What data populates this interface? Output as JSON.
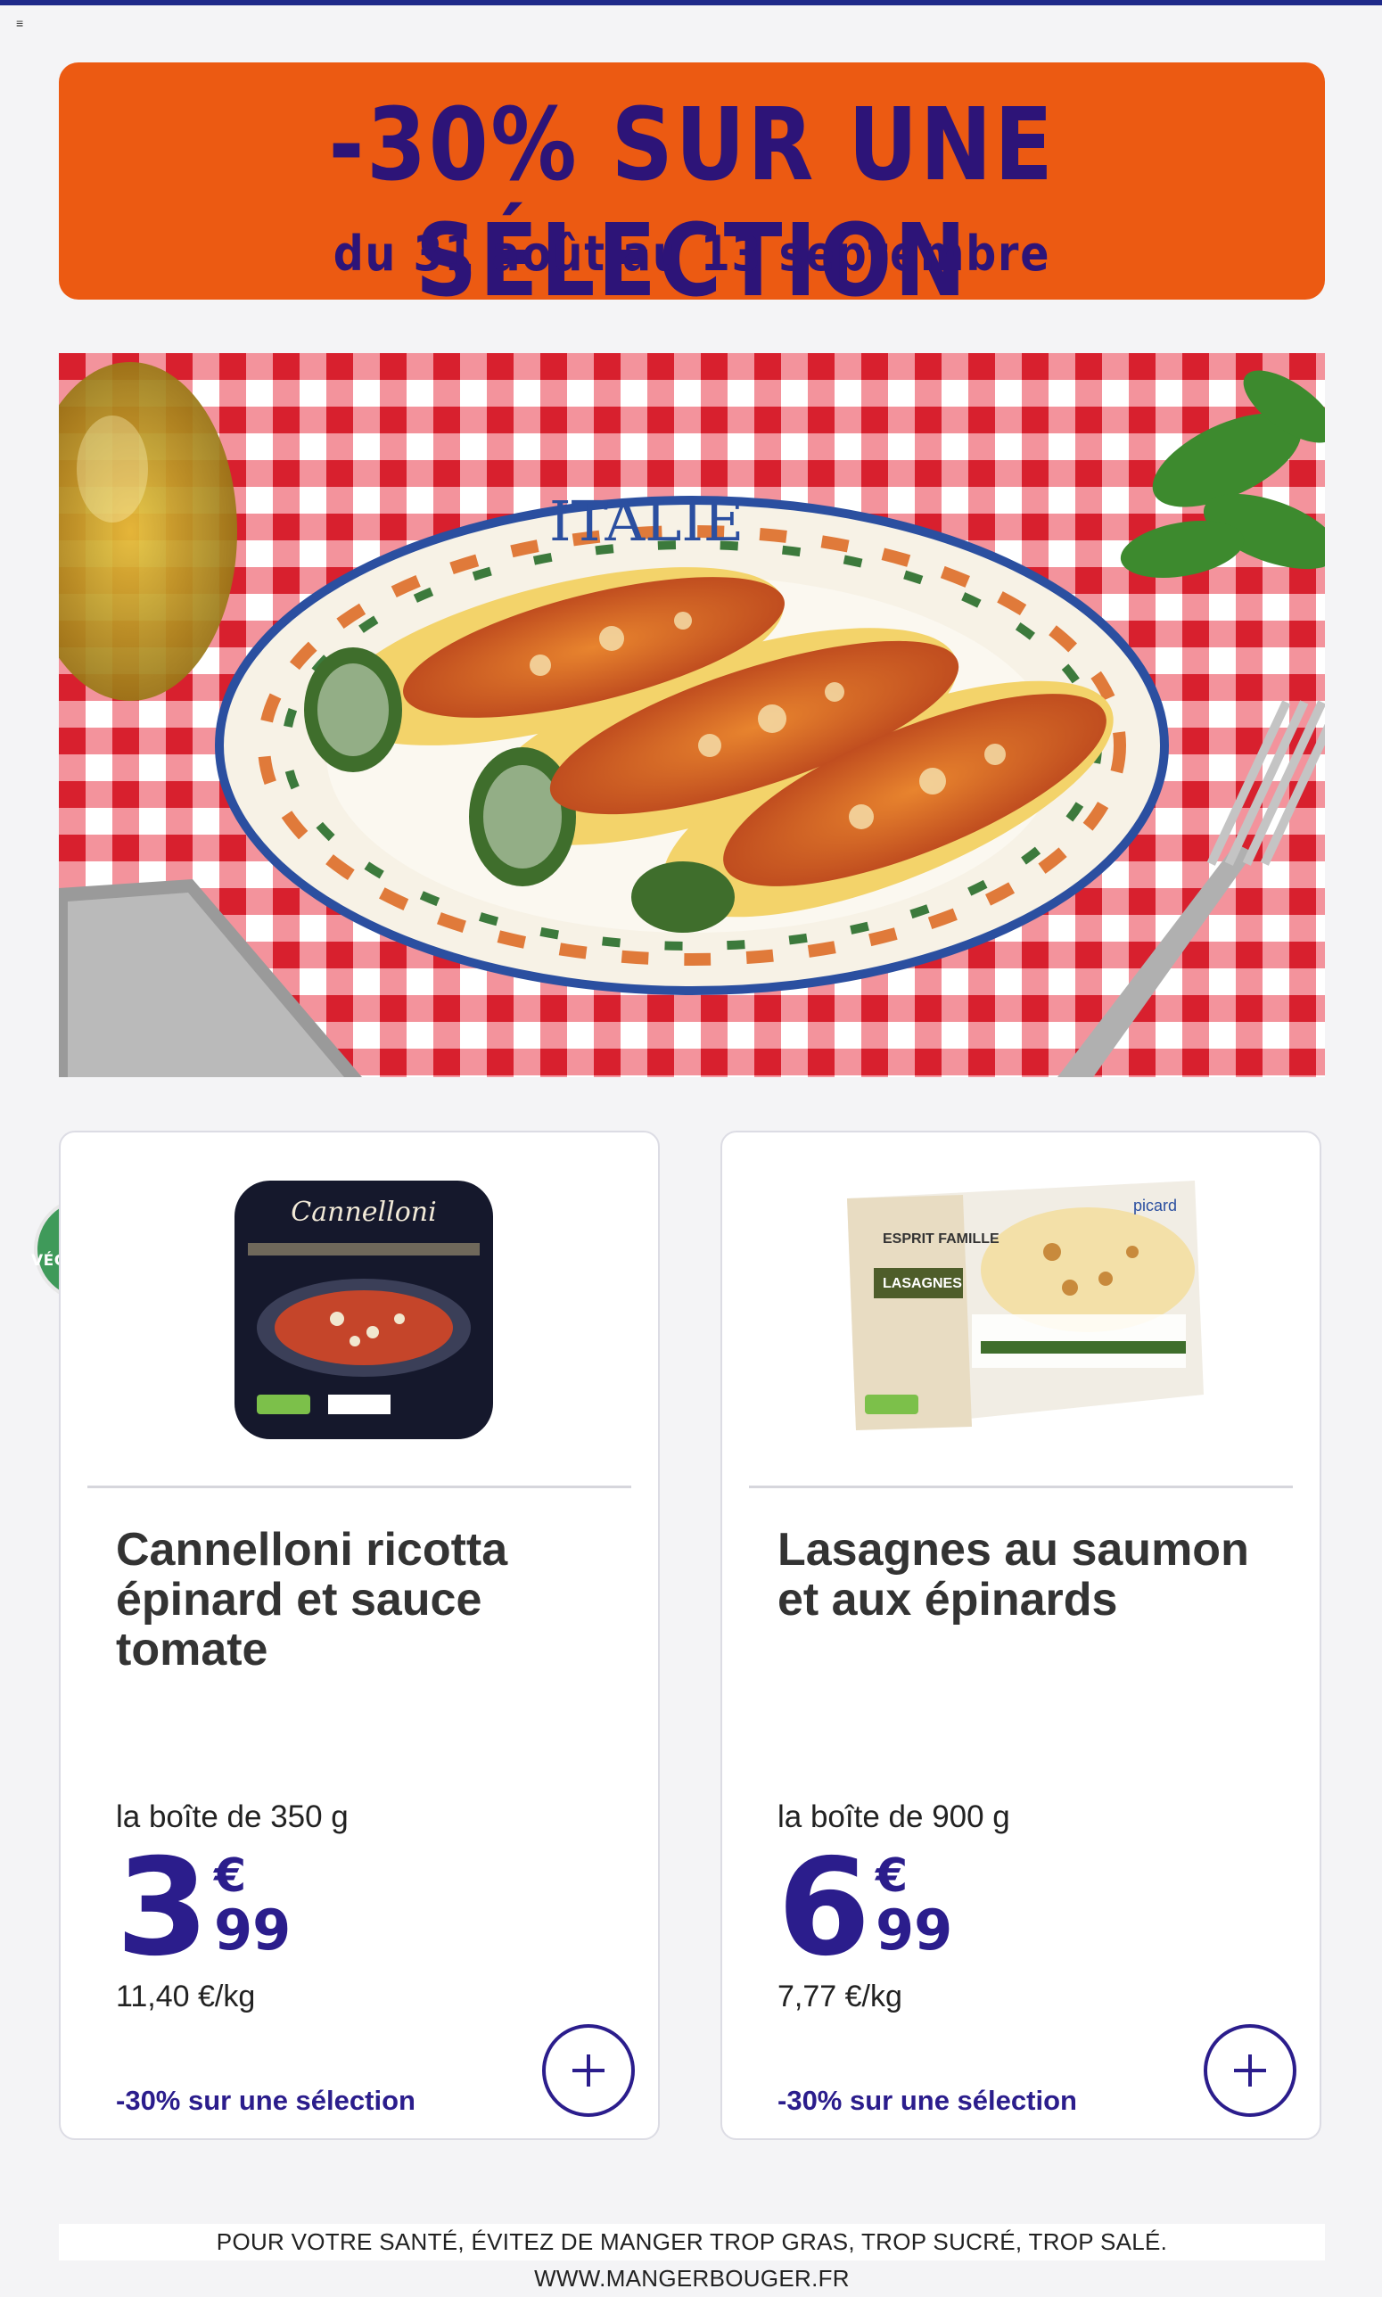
{
  "banner": {
    "title": "-30% SUR UNE SÉLECTION",
    "dates": "du 31 août au 13 septembre"
  },
  "hero": {
    "plate_text": "ITALIE"
  },
  "products": [
    {
      "badge": "VÉGÉTARIEN",
      "package_brand": "Cannelloni",
      "title": "Cannelloni ricotta épinard et sauce tomate",
      "unit_label": "la boîte de 350 g",
      "price_int": "3",
      "price_currency": "€",
      "price_cents": "99",
      "price_per_kg": "11,40 €/kg",
      "promo": "-30% sur une sélection",
      "add_icon": "plus-icon"
    },
    {
      "package_brand": "picard",
      "package_line": "ESPRIT FAMILLE",
      "package_product": "LASAGNES",
      "title": "Lasagnes au saumon et aux épinards",
      "unit_label": "la boîte de 900 g",
      "price_int": "6",
      "price_currency": "€",
      "price_cents": "99",
      "price_per_kg": "7,77 €/kg",
      "promo": "-30% sur une sélection",
      "add_icon": "plus-icon"
    }
  ],
  "footer": {
    "text": "POUR VOTRE SANTÉ, ÉVITEZ DE MANGER TROP GRAS, TROP SUCRÉ, TROP SALÉ. WWW.MANGERBOUGER.FR"
  },
  "colors": {
    "banner": "#ec5a12",
    "brand_blue": "#2b1d8c",
    "vegetarian_green": "#3f9a5a"
  }
}
